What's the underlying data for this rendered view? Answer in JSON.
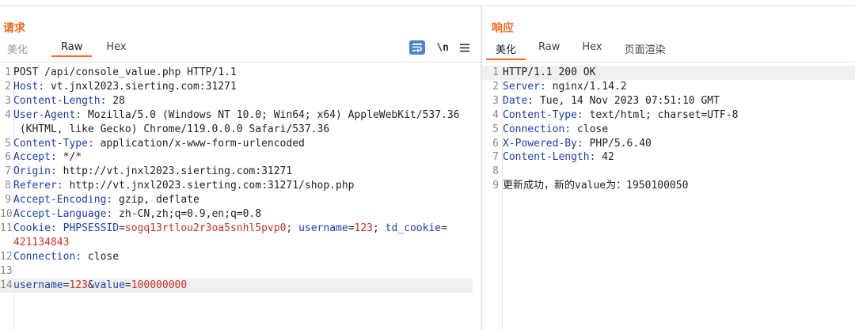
{
  "request": {
    "title": "请求",
    "tabs": [
      "美化",
      "Raw",
      "Hex"
    ],
    "active_tab": "Raw",
    "toolbar": {
      "wrap_icon": "text-wrap-icon",
      "newline_label": "\\n",
      "menu_icon": "menu-icon"
    },
    "lines": [
      {
        "n": "1",
        "segs": [
          {
            "t": "txt",
            "v": "POST /api/console_value.php HTTP/1.1"
          }
        ]
      },
      {
        "n": "2",
        "segs": [
          {
            "t": "key",
            "v": "Host:"
          },
          {
            "t": "txt",
            "v": " vt.jnxl2023.sierting.com:31271"
          }
        ]
      },
      {
        "n": "3",
        "segs": [
          {
            "t": "key",
            "v": "Content-Length:"
          },
          {
            "t": "txt",
            "v": " 28"
          }
        ]
      },
      {
        "n": "4",
        "segs": [
          {
            "t": "key",
            "v": "User-Agent:"
          },
          {
            "t": "txt",
            "v": " Mozilla/5.0 (Windows NT 10.0; Win64; x64) AppleWebKit/537.36"
          }
        ]
      },
      {
        "n": "",
        "segs": [
          {
            "t": "txt",
            "v": " (KHTML, like Gecko) Chrome/119.0.0.0 Safari/537.36"
          }
        ]
      },
      {
        "n": "5",
        "segs": [
          {
            "t": "key",
            "v": "Content-Type:"
          },
          {
            "t": "txt",
            "v": " application/x-www-form-urlencoded"
          }
        ]
      },
      {
        "n": "6",
        "segs": [
          {
            "t": "key",
            "v": "Accept:"
          },
          {
            "t": "txt",
            "v": " */*"
          }
        ]
      },
      {
        "n": "7",
        "segs": [
          {
            "t": "key",
            "v": "Origin:"
          },
          {
            "t": "txt",
            "v": " http://vt.jnxl2023.sierting.com:31271"
          }
        ]
      },
      {
        "n": "8",
        "segs": [
          {
            "t": "key",
            "v": "Referer:"
          },
          {
            "t": "txt",
            "v": " http://vt.jnxl2023.sierting.com:31271/shop.php"
          }
        ]
      },
      {
        "n": "9",
        "segs": [
          {
            "t": "key",
            "v": "Accept-Encoding:"
          },
          {
            "t": "txt",
            "v": " gzip, deflate"
          }
        ]
      },
      {
        "n": "10",
        "segs": [
          {
            "t": "key",
            "v": "Accept-Language:"
          },
          {
            "t": "txt",
            "v": " zh-CN,zh;q=0.9,en;q=0.8"
          }
        ]
      },
      {
        "n": "11",
        "segs": [
          {
            "t": "key",
            "v": "Cookie:"
          },
          {
            "t": "txt",
            "v": " "
          },
          {
            "t": "key",
            "v": "PHPSESSID"
          },
          {
            "t": "txt",
            "v": "="
          },
          {
            "t": "val",
            "v": "sogq13rtlou2r3oa5snhl5pvp0"
          },
          {
            "t": "txt",
            "v": "; "
          },
          {
            "t": "key",
            "v": "username"
          },
          {
            "t": "txt",
            "v": "="
          },
          {
            "t": "val",
            "v": "123"
          },
          {
            "t": "txt",
            "v": "; "
          },
          {
            "t": "key",
            "v": "td_cookie"
          },
          {
            "t": "txt",
            "v": "="
          }
        ]
      },
      {
        "n": "",
        "segs": [
          {
            "t": "val",
            "v": "421134843"
          }
        ]
      },
      {
        "n": "12",
        "segs": [
          {
            "t": "key",
            "v": "Connection:"
          },
          {
            "t": "txt",
            "v": " close"
          }
        ]
      },
      {
        "n": "13",
        "segs": []
      },
      {
        "n": "14",
        "hl": true,
        "segs": [
          {
            "t": "key",
            "v": "username"
          },
          {
            "t": "txt",
            "v": "="
          },
          {
            "t": "val",
            "v": "123"
          },
          {
            "t": "txt",
            "v": "&"
          },
          {
            "t": "key",
            "v": "value"
          },
          {
            "t": "txt",
            "v": "="
          },
          {
            "t": "val",
            "v": "100000000"
          }
        ]
      }
    ]
  },
  "response": {
    "title": "响应",
    "tabs": [
      "美化",
      "Raw",
      "Hex",
      "页面渲染"
    ],
    "active_tab": "美化",
    "lines": [
      {
        "n": "1",
        "hl": true,
        "segs": [
          {
            "t": "txt",
            "v": "HTTP/1.1 200 OK"
          }
        ]
      },
      {
        "n": "2",
        "segs": [
          {
            "t": "key",
            "v": "Server:"
          },
          {
            "t": "txt",
            "v": " nginx/1.14.2"
          }
        ]
      },
      {
        "n": "3",
        "segs": [
          {
            "t": "key",
            "v": "Date:"
          },
          {
            "t": "txt",
            "v": " Tue, 14 Nov 2023 07:51:10 GMT"
          }
        ]
      },
      {
        "n": "4",
        "segs": [
          {
            "t": "key",
            "v": "Content-Type:"
          },
          {
            "t": "txt",
            "v": " text/html; charset=UTF-8"
          }
        ]
      },
      {
        "n": "5",
        "segs": [
          {
            "t": "key",
            "v": "Connection:"
          },
          {
            "t": "txt",
            "v": " close"
          }
        ]
      },
      {
        "n": "6",
        "segs": [
          {
            "t": "key",
            "v": "X-Powered-By:"
          },
          {
            "t": "txt",
            "v": " PHP/5.6.40"
          }
        ]
      },
      {
        "n": "7",
        "segs": [
          {
            "t": "key",
            "v": "Content-Length:"
          },
          {
            "t": "txt",
            "v": " 42"
          }
        ]
      },
      {
        "n": "8",
        "segs": []
      },
      {
        "n": "9",
        "segs": [
          {
            "t": "txt",
            "v": "更新成功，新的value为：1950100050"
          }
        ]
      }
    ]
  },
  "colors": {
    "accent": "#ef6a1f",
    "header_key": "#1f3fa8",
    "param_value": "#c2322b",
    "wrap_button": "#4a86c5"
  }
}
